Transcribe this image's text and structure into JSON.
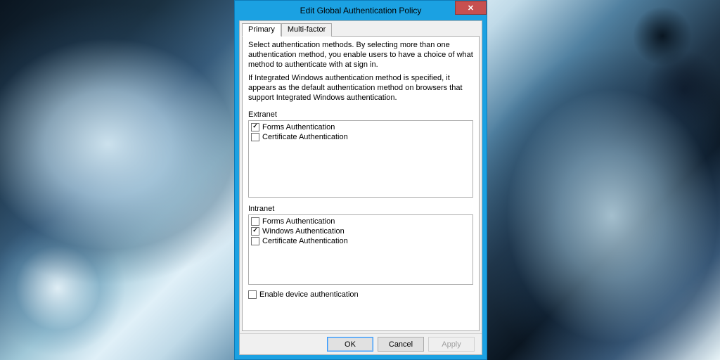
{
  "dialog": {
    "title": "Edit Global Authentication Policy"
  },
  "tabs": {
    "primary": "Primary",
    "multifactor": "Multi-factor"
  },
  "descriptions": {
    "line1": "Select authentication methods. By selecting more than one authentication method, you enable users to have a choice of what method to authenticate with at sign in.",
    "line2": "If Integrated Windows authentication method is specified, it appears as the default authentication method on browsers that support Integrated Windows authentication."
  },
  "groups": {
    "extranet": {
      "label": "Extranet",
      "items": [
        {
          "label": "Forms Authentication",
          "checked": true
        },
        {
          "label": "Certificate Authentication",
          "checked": false
        }
      ]
    },
    "intranet": {
      "label": "Intranet",
      "items": [
        {
          "label": "Forms Authentication",
          "checked": false
        },
        {
          "label": "Windows Authentication",
          "checked": true
        },
        {
          "label": "Certificate Authentication",
          "checked": false
        }
      ]
    }
  },
  "device_auth": {
    "label": "Enable device authentication",
    "checked": false
  },
  "buttons": {
    "ok": "OK",
    "cancel": "Cancel",
    "apply": "Apply"
  }
}
